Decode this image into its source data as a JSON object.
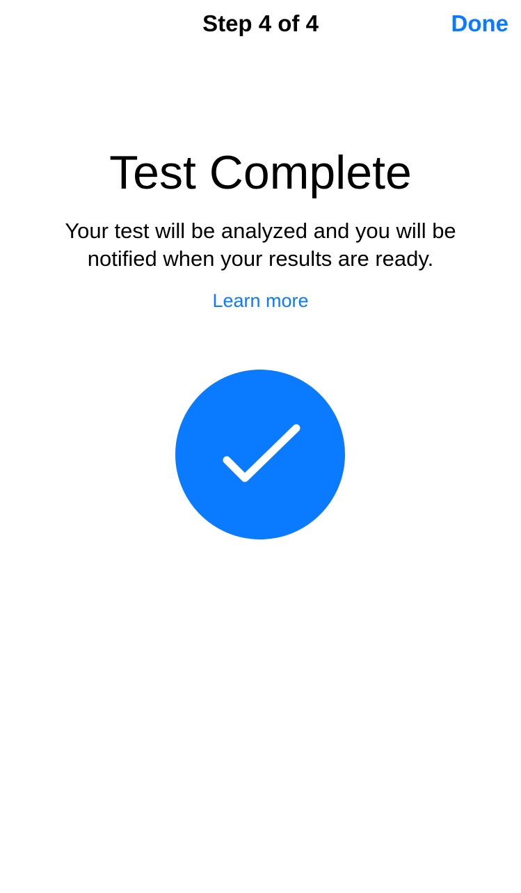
{
  "nav": {
    "title": "Step 4 of 4",
    "done_label": "Done"
  },
  "content": {
    "heading": "Test Complete",
    "message": "Your test will be analyzed and you will be notified when your results are ready.",
    "learn_more": "Learn more"
  },
  "icons": {
    "status": "checkmark-circle-icon"
  },
  "colors": {
    "accent": "#0a7aff",
    "check_circle": "#0a7aff",
    "text": "#000000",
    "background": "#ffffff"
  }
}
